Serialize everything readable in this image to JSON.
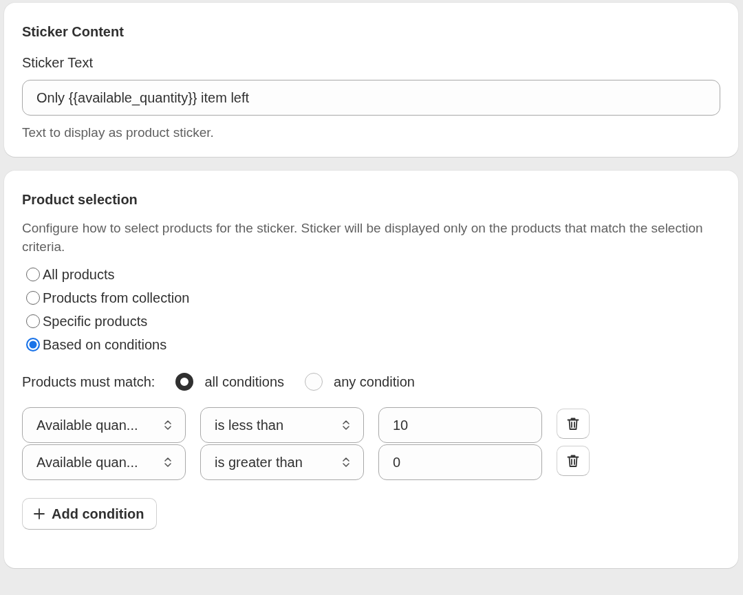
{
  "sticker_content": {
    "title": "Sticker Content",
    "field_label": "Sticker Text",
    "field_value": "Only {{available_quantity}} item left",
    "help_text": "Text to display as product sticker."
  },
  "product_selection": {
    "title": "Product selection",
    "description": "Configure how to select products for the sticker. Sticker will be displayed only on the products that match the selection criteria.",
    "options": [
      {
        "label": "All products",
        "selected": false
      },
      {
        "label": "Products from collection",
        "selected": false
      },
      {
        "label": "Specific products",
        "selected": false
      },
      {
        "label": "Based on conditions",
        "selected": true
      }
    ],
    "match_label": "Products must match:",
    "match_options": [
      {
        "label": "all conditions",
        "selected": true
      },
      {
        "label": "any condition",
        "selected": false
      }
    ],
    "conditions": [
      {
        "field": "Available quan...",
        "operator": "is less than",
        "value": "10"
      },
      {
        "field": "Available quan...",
        "operator": "is greater than",
        "value": "0"
      }
    ],
    "add_button": "Add condition"
  }
}
